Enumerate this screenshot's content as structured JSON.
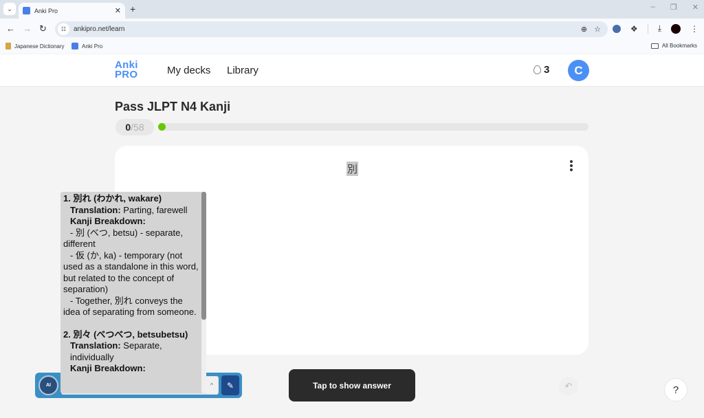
{
  "browser": {
    "tab_title": "Anki Pro",
    "url": "ankipro.net/learn",
    "bookmarks": [
      {
        "label": "Japanese Dictionary"
      },
      {
        "label": "Anki Pro"
      }
    ],
    "all_bookmarks_label": "All Bookmarks",
    "icons": {
      "tab_menu": "⌄",
      "close": "✕",
      "new_tab": "+",
      "minimize": "–",
      "restore": "❐",
      "window_close": "✕",
      "back": "←",
      "forward": "→",
      "reload": "↻",
      "site_info": "☷",
      "zoom": "⊕",
      "star": "☆",
      "extensions": "❖",
      "download": "⤓",
      "more": "⋮"
    }
  },
  "header": {
    "logo_line1": "Anki",
    "logo_line2": "PRO",
    "nav": [
      {
        "label": "My decks"
      },
      {
        "label": "Library"
      }
    ],
    "streak_count": "3",
    "avatar_initial": "C",
    "brand_color": "#4a90f5"
  },
  "deck": {
    "title": "Pass JLPT N4 Kanji",
    "progress_done": "0",
    "progress_total": "/58",
    "progress_fraction": 0,
    "progress_color": "#65c800"
  },
  "card": {
    "front": "別",
    "show_answer_label": "Tap to show answer",
    "undo_icon": "↶",
    "help_label": "?"
  },
  "extension": {
    "logo_label": "AI",
    "caret": "^",
    "edit_icon": "✎",
    "popup": {
      "entry1_heading": "1. 別れ (わかれ, wakare)",
      "entry1_translation_label": "Translation:",
      "entry1_translation": " Parting, farewell",
      "entry1_breakdown_label": "Kanji Breakdown:",
      "entry1_line1": "- 別 (べつ, betsu) - separate, different",
      "entry1_line2": "- 仮 (か, ka) - temporary (not used as a standalone in this word, but related to the concept of separation)",
      "entry1_line3": "- Together, 別れ conveys the idea of separating from someone.",
      "entry2_heading": "2. 別々 (べつべつ, betsubetsu)",
      "entry2_translation_label": "Translation:",
      "entry2_translation": " Separate, individually",
      "entry2_breakdown_label": "Kanji Breakdown:"
    }
  }
}
